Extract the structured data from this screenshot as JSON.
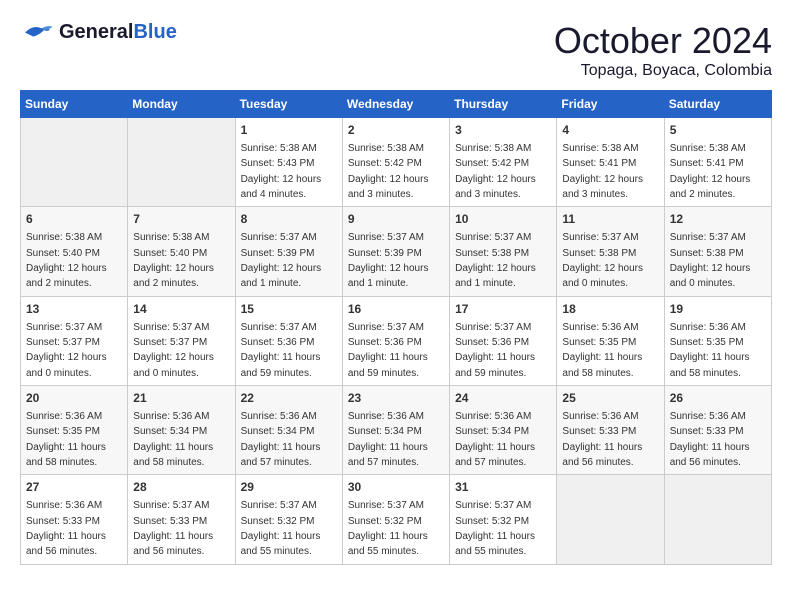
{
  "header": {
    "logo_general": "General",
    "logo_blue": "Blue",
    "month": "October 2024",
    "location": "Topaga, Boyaca, Colombia"
  },
  "weekdays": [
    "Sunday",
    "Monday",
    "Tuesday",
    "Wednesday",
    "Thursday",
    "Friday",
    "Saturday"
  ],
  "weeks": [
    [
      {
        "day": "",
        "info": ""
      },
      {
        "day": "",
        "info": ""
      },
      {
        "day": "1",
        "info": "Sunrise: 5:38 AM\nSunset: 5:43 PM\nDaylight: 12 hours and 4 minutes."
      },
      {
        "day": "2",
        "info": "Sunrise: 5:38 AM\nSunset: 5:42 PM\nDaylight: 12 hours and 3 minutes."
      },
      {
        "day": "3",
        "info": "Sunrise: 5:38 AM\nSunset: 5:42 PM\nDaylight: 12 hours and 3 minutes."
      },
      {
        "day": "4",
        "info": "Sunrise: 5:38 AM\nSunset: 5:41 PM\nDaylight: 12 hours and 3 minutes."
      },
      {
        "day": "5",
        "info": "Sunrise: 5:38 AM\nSunset: 5:41 PM\nDaylight: 12 hours and 2 minutes."
      }
    ],
    [
      {
        "day": "6",
        "info": "Sunrise: 5:38 AM\nSunset: 5:40 PM\nDaylight: 12 hours and 2 minutes."
      },
      {
        "day": "7",
        "info": "Sunrise: 5:38 AM\nSunset: 5:40 PM\nDaylight: 12 hours and 2 minutes."
      },
      {
        "day": "8",
        "info": "Sunrise: 5:37 AM\nSunset: 5:39 PM\nDaylight: 12 hours and 1 minute."
      },
      {
        "day": "9",
        "info": "Sunrise: 5:37 AM\nSunset: 5:39 PM\nDaylight: 12 hours and 1 minute."
      },
      {
        "day": "10",
        "info": "Sunrise: 5:37 AM\nSunset: 5:38 PM\nDaylight: 12 hours and 1 minute."
      },
      {
        "day": "11",
        "info": "Sunrise: 5:37 AM\nSunset: 5:38 PM\nDaylight: 12 hours and 0 minutes."
      },
      {
        "day": "12",
        "info": "Sunrise: 5:37 AM\nSunset: 5:38 PM\nDaylight: 12 hours and 0 minutes."
      }
    ],
    [
      {
        "day": "13",
        "info": "Sunrise: 5:37 AM\nSunset: 5:37 PM\nDaylight: 12 hours and 0 minutes."
      },
      {
        "day": "14",
        "info": "Sunrise: 5:37 AM\nSunset: 5:37 PM\nDaylight: 12 hours and 0 minutes."
      },
      {
        "day": "15",
        "info": "Sunrise: 5:37 AM\nSunset: 5:36 PM\nDaylight: 11 hours and 59 minutes."
      },
      {
        "day": "16",
        "info": "Sunrise: 5:37 AM\nSunset: 5:36 PM\nDaylight: 11 hours and 59 minutes."
      },
      {
        "day": "17",
        "info": "Sunrise: 5:37 AM\nSunset: 5:36 PM\nDaylight: 11 hours and 59 minutes."
      },
      {
        "day": "18",
        "info": "Sunrise: 5:36 AM\nSunset: 5:35 PM\nDaylight: 11 hours and 58 minutes."
      },
      {
        "day": "19",
        "info": "Sunrise: 5:36 AM\nSunset: 5:35 PM\nDaylight: 11 hours and 58 minutes."
      }
    ],
    [
      {
        "day": "20",
        "info": "Sunrise: 5:36 AM\nSunset: 5:35 PM\nDaylight: 11 hours and 58 minutes."
      },
      {
        "day": "21",
        "info": "Sunrise: 5:36 AM\nSunset: 5:34 PM\nDaylight: 11 hours and 58 minutes."
      },
      {
        "day": "22",
        "info": "Sunrise: 5:36 AM\nSunset: 5:34 PM\nDaylight: 11 hours and 57 minutes."
      },
      {
        "day": "23",
        "info": "Sunrise: 5:36 AM\nSunset: 5:34 PM\nDaylight: 11 hours and 57 minutes."
      },
      {
        "day": "24",
        "info": "Sunrise: 5:36 AM\nSunset: 5:34 PM\nDaylight: 11 hours and 57 minutes."
      },
      {
        "day": "25",
        "info": "Sunrise: 5:36 AM\nSunset: 5:33 PM\nDaylight: 11 hours and 56 minutes."
      },
      {
        "day": "26",
        "info": "Sunrise: 5:36 AM\nSunset: 5:33 PM\nDaylight: 11 hours and 56 minutes."
      }
    ],
    [
      {
        "day": "27",
        "info": "Sunrise: 5:36 AM\nSunset: 5:33 PM\nDaylight: 11 hours and 56 minutes."
      },
      {
        "day": "28",
        "info": "Sunrise: 5:37 AM\nSunset: 5:33 PM\nDaylight: 11 hours and 56 minutes."
      },
      {
        "day": "29",
        "info": "Sunrise: 5:37 AM\nSunset: 5:32 PM\nDaylight: 11 hours and 55 minutes."
      },
      {
        "day": "30",
        "info": "Sunrise: 5:37 AM\nSunset: 5:32 PM\nDaylight: 11 hours and 55 minutes."
      },
      {
        "day": "31",
        "info": "Sunrise: 5:37 AM\nSunset: 5:32 PM\nDaylight: 11 hours and 55 minutes."
      },
      {
        "day": "",
        "info": ""
      },
      {
        "day": "",
        "info": ""
      }
    ]
  ]
}
